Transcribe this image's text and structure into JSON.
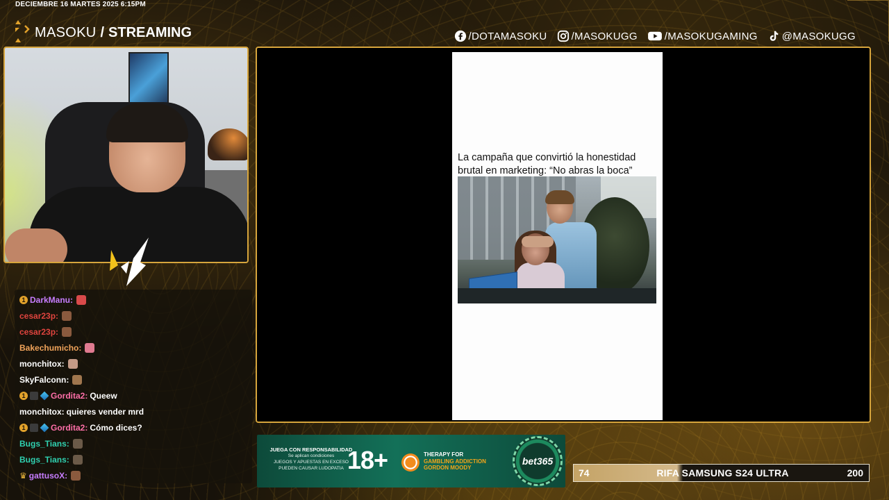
{
  "header": {
    "datetime": "DECIEMBRE 16 MARTES 2025 6:15PM",
    "brand_name": "MASOKU",
    "brand_separator": "/",
    "brand_section": "STREAMING"
  },
  "socials": [
    {
      "icon": "facebook-icon",
      "handle": "/DOTAMASOKU"
    },
    {
      "icon": "instagram-icon",
      "handle": "/MASOKUGG"
    },
    {
      "icon": "youtube-icon",
      "handle": "/MASOKUGAMING"
    },
    {
      "icon": "tiktok-icon",
      "handle": "@MASOKUGG"
    }
  ],
  "chat": {
    "messages": [
      {
        "user": "DarkManu:",
        "color": "#c77dff",
        "badges": [
          "1"
        ],
        "text": "",
        "emote": "#d94a4a"
      },
      {
        "user": "cesar23p:",
        "color": "#e0443e",
        "badges": [],
        "text": "",
        "emote": "#8a5a3e"
      },
      {
        "user": "cesar23p:",
        "color": "#e0443e",
        "badges": [],
        "text": "",
        "emote": "#8a5a3e"
      },
      {
        "user": "Bakechumicho:",
        "color": "#f0a35a",
        "badges": [],
        "text": "",
        "emote": "#e07a90"
      },
      {
        "user": "monchitox:",
        "color": "#ffffff",
        "badges": [],
        "text": "",
        "emote": "#c49a86"
      },
      {
        "user": "SkyFalconn:",
        "color": "#ffffff",
        "badges": [],
        "text": "",
        "emote": "#a0764e"
      },
      {
        "user": "Gordita2:",
        "color": "#ff6fa8",
        "badges": [
          "1",
          "sq",
          "gem"
        ],
        "text": "Queew",
        "emote": ""
      },
      {
        "user": "monchitox:",
        "color": "#ffffff",
        "badges": [],
        "text": "quieres vender mrd",
        "emote": ""
      },
      {
        "user": "Gordita2:",
        "color": "#ff6fa8",
        "badges": [
          "1",
          "sq",
          "gem"
        ],
        "text": "Cómo dices?",
        "emote": ""
      },
      {
        "user": "Bugs_Tians:",
        "color": "#2fd0b0",
        "badges": [],
        "text": "",
        "emote": "#6b5a48"
      },
      {
        "user": "Bugs_Tians:",
        "color": "#2fd0b0",
        "badges": [],
        "text": "",
        "emote": "#6b5a48"
      },
      {
        "user": "gattusoX:",
        "color": "#c77dff",
        "badges": [
          "crown"
        ],
        "text": "",
        "emote": "#8a5a3e"
      }
    ]
  },
  "video": {
    "headline": "La campaña que convirtió la honestidad brutal en marketing: “No abras la boca”"
  },
  "ad": {
    "rg_title": "JUEGA CON RESPONSABILIDAD",
    "rg_line1": "Se aplican condiciones",
    "rg_line2": "JUEGOS Y APUESTAS EN EXCESO",
    "rg_line3": "PUEDEN CAUSAR LUDOPATIA",
    "age": "18+",
    "therapy_line1": "THERAPY FOR",
    "therapy_line2": "GAMBLING ADDICTION",
    "therapy_line3": "GORDON MOODY",
    "brand": "bet365"
  },
  "raffle": {
    "current": "74",
    "title": "RIFA SAMSUNG S24 ULTRA",
    "goal": "200",
    "progress_fraction": 0.37
  },
  "colors": {
    "accent": "#d7a53c",
    "background": "#17120a"
  }
}
